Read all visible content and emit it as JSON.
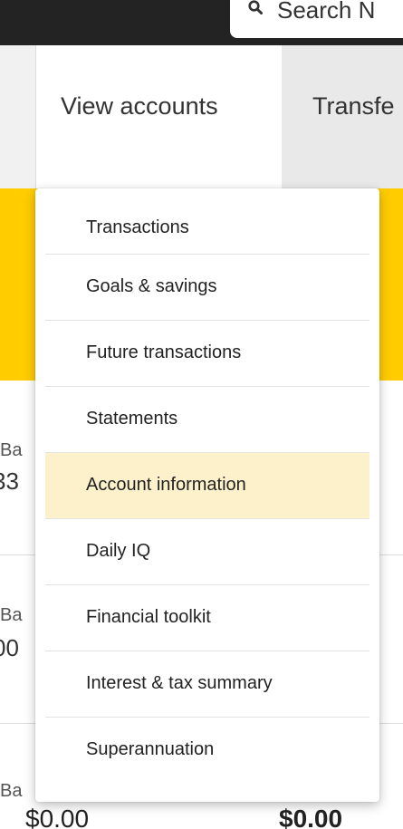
{
  "header": {
    "search_placeholder": "Search N"
  },
  "nav": {
    "view_accounts": "View accounts",
    "transfer": "Transfe"
  },
  "accounts": [
    {
      "label": "Ba",
      "value": "33"
    },
    {
      "label": "Ba",
      "value": "00"
    },
    {
      "label": "Ba"
    }
  ],
  "bottom": {
    "amount_left": "$0.00",
    "amount_right": "$0.00"
  },
  "dropdown": {
    "items": [
      {
        "label": "Transactions"
      },
      {
        "label": "Goals & savings"
      },
      {
        "label": "Future transactions"
      },
      {
        "label": "Statements"
      },
      {
        "label": "Account information",
        "active": true
      },
      {
        "label": "Daily IQ"
      },
      {
        "label": "Financial toolkit"
      },
      {
        "label": "Interest & tax summary"
      },
      {
        "label": "Superannuation"
      }
    ]
  },
  "colors": {
    "topbar": "#232323",
    "accent_yellow": "#ffcc00",
    "active_item": "#fdf1cc"
  }
}
